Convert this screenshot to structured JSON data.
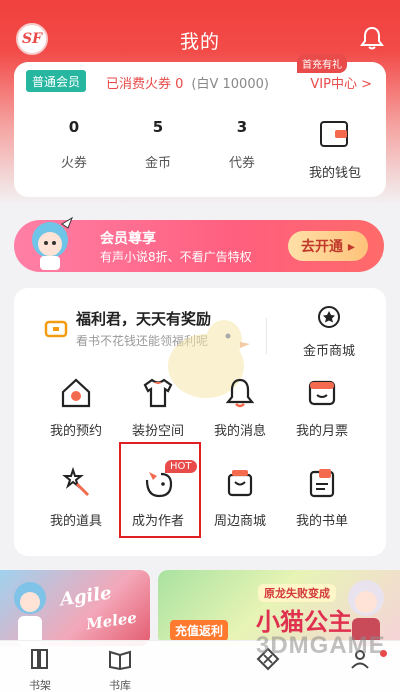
{
  "header": {
    "title": "我的",
    "logo_text": "SF",
    "accent": "#f0413f"
  },
  "account": {
    "badge": "普通会员",
    "consumed": "已消费火券 0",
    "bai_v": "(白V 10000)",
    "vip_link": "VIP中心 >",
    "stats": [
      {
        "value": "0",
        "label": "火券"
      },
      {
        "value": "5",
        "label": "金币"
      },
      {
        "value": "3",
        "label": "代券"
      }
    ],
    "wallet": {
      "label": "我的钱包",
      "tag": "首充有礼"
    }
  },
  "vip_banner": {
    "title": "会员尊享",
    "subtitle": "有声小说8折、不看广告特权",
    "button": "去开通 ▸"
  },
  "welfare": {
    "title": "福利君，天天有奖励",
    "subtitle": "看书不花钱还能领福利呢",
    "coin_shop": "金币商城"
  },
  "grid": [
    {
      "label": "我的预约",
      "icon": "calendar-house-icon"
    },
    {
      "label": "装扮空间",
      "icon": "tshirt-icon"
    },
    {
      "label": "我的消息",
      "icon": "bell-icon"
    },
    {
      "label": "我的月票",
      "icon": "ticket-icon"
    },
    {
      "label": "我的道具",
      "icon": "magic-wand-icon"
    },
    {
      "label": "成为作者",
      "icon": "chick-author-icon",
      "tag": "HOT"
    },
    {
      "label": "周边商城",
      "icon": "shopping-bag-icon"
    },
    {
      "label": "我的书单",
      "icon": "book-list-icon"
    }
  ],
  "banners": {
    "left": {
      "line1": "Agile",
      "line2": "Melee"
    },
    "right": {
      "small": "原龙失败变成",
      "big": "小猫公主",
      "tag": "充值返利"
    }
  },
  "tabbar": [
    {
      "label": "书架",
      "icon": "bookshelf-icon"
    },
    {
      "label": "书库",
      "icon": "open-book-icon"
    },
    {
      "label": "",
      "icon": "diamond-icon"
    },
    {
      "label": "",
      "icon": "profile-icon"
    }
  ],
  "watermark": "3DMGAME"
}
